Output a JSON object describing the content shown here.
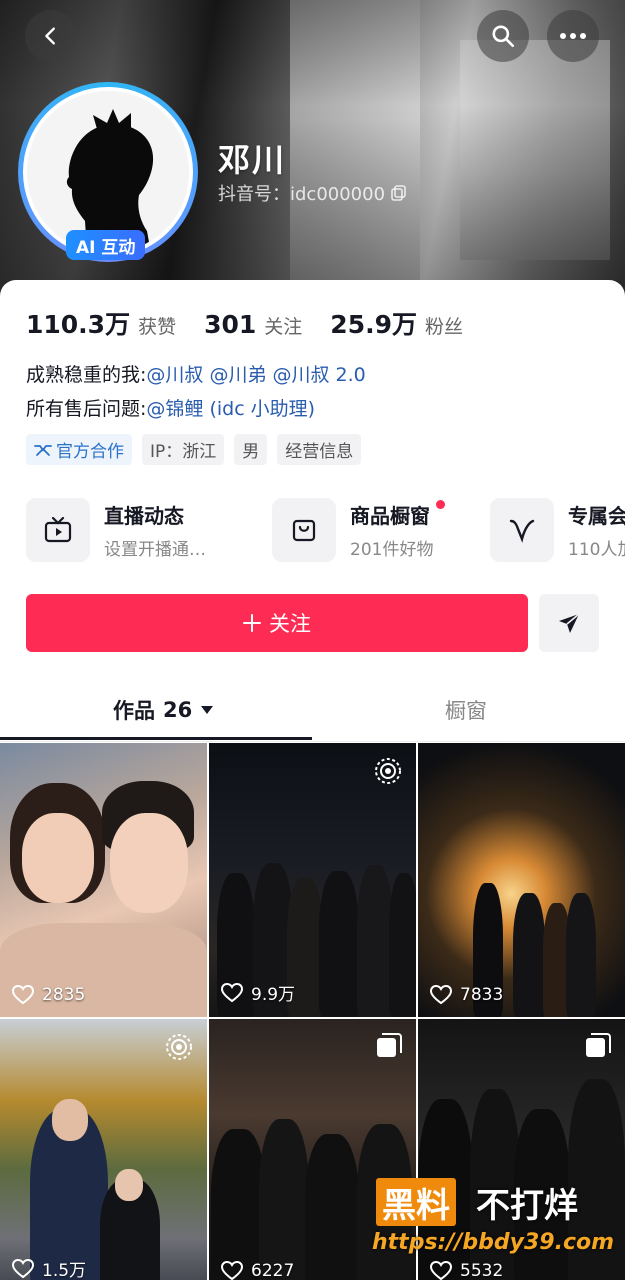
{
  "header": {
    "name": "邓川",
    "douyin_id": "抖音号：idc000000",
    "ai_badge": "AI 互动"
  },
  "stats": [
    {
      "value": "110.3万",
      "label": "获赞"
    },
    {
      "value": "301",
      "label": "关注"
    },
    {
      "value": "25.9万",
      "label": "粉丝"
    }
  ],
  "bio": {
    "line1_prefix": "成熟稳重的我:",
    "line1_mentions": "@川叔 @川弟 @川叔 2.0",
    "line2_prefix": "所有售后问题:",
    "line2_mentions": "@锦鲤 (idc 小助理)"
  },
  "tags": {
    "official": "官方合作",
    "ip": "IP：浙江",
    "gender": "男",
    "business": "经营信息"
  },
  "services": [
    {
      "title": "直播动态",
      "subtitle": "设置开播通…"
    },
    {
      "title": "商品橱窗",
      "subtitle": "201件好物"
    },
    {
      "title": "专属会",
      "subtitle": "110人加"
    }
  ],
  "actions": {
    "follow": "关注"
  },
  "tabs": {
    "works_label": "作品",
    "works_count": "26",
    "shop_label": "橱窗"
  },
  "videos": [
    {
      "likes": "2835"
    },
    {
      "likes": "9.9万"
    },
    {
      "likes": "7833"
    },
    {
      "likes": "1.5万"
    },
    {
      "likes": "6227"
    },
    {
      "likes": "5532"
    }
  ],
  "watermark": {
    "box": "黑料",
    "text": "不打烊",
    "url": "https://bbdy39.com"
  },
  "colors": {
    "accent": "#fe2c55",
    "mention": "#2a5db0",
    "ai_badge": "#1e90ff"
  }
}
